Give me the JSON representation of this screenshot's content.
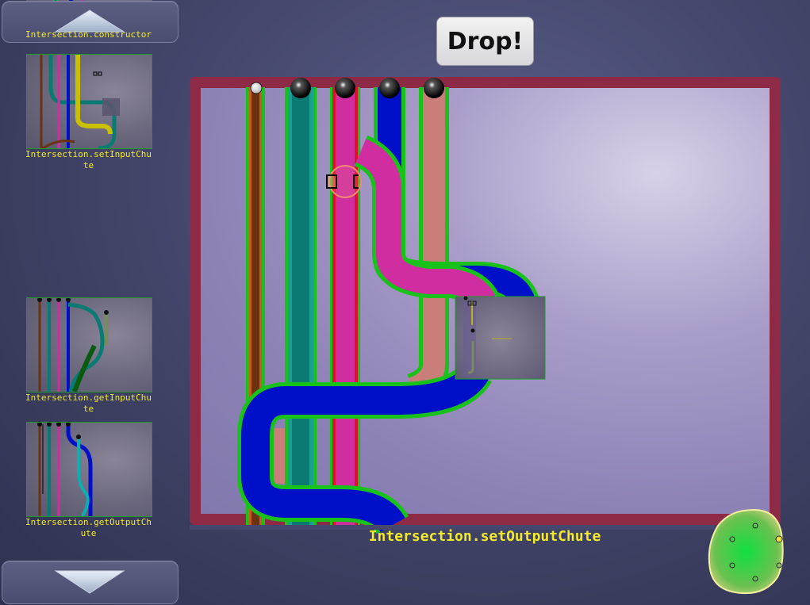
{
  "drop_button": {
    "label": "Drop!"
  },
  "level_title": "Intersection.setOutputChute",
  "sidebar": {
    "levels": [
      {
        "label": "Intersection.constructor"
      },
      {
        "label": "Intersection.setInputChute"
      },
      {
        "label": "Intersection.getInputChute"
      },
      {
        "label": "Intersection.getOutputChute"
      }
    ]
  },
  "colors": {
    "board_frame": "#8e2a45",
    "pipe_outline": "#19c21a",
    "pipe_brown": "#6b3210",
    "pipe_teal": "#0a7a72",
    "pipe_magenta": "#d02ea0",
    "pipe_blue": "#0010c8",
    "pipe_salmon": "#c97e7a",
    "label_text": "#f3ea2a"
  },
  "icons": {
    "scroll_up": "triangle-up-icon",
    "scroll_down": "triangle-down-icon",
    "ball": "black-ball-icon",
    "white_ball": "white-ball-icon",
    "minimap": "green-blob-minimap-icon"
  }
}
